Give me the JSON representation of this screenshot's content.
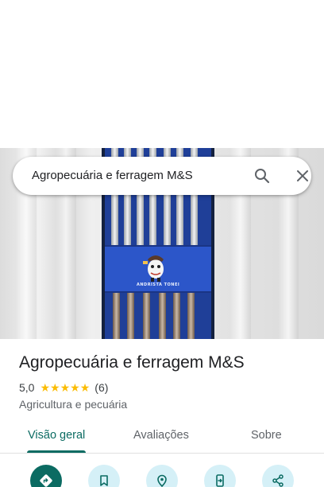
{
  "search": {
    "query": "Agropecuária e ferragem M&S",
    "search_icon": "search-icon",
    "close_icon": "close-icon"
  },
  "hero": {
    "mascot_caption": "ANDRISTA TONEI"
  },
  "place": {
    "name": "Agropecuária e ferragem M&S",
    "rating": "5,0",
    "stars": 5,
    "reviews": "(6)",
    "category": "Agricultura e pecuária"
  },
  "tabs": [
    {
      "label": "Visão geral",
      "active": true
    },
    {
      "label": "Avaliações",
      "active": false
    },
    {
      "label": "Sobre",
      "active": false
    }
  ],
  "actions": [
    {
      "icon": "directions-icon",
      "primary": true
    },
    {
      "icon": "bookmark-icon",
      "primary": false
    },
    {
      "icon": "nearby-icon",
      "primary": false
    },
    {
      "icon": "send-to-phone-icon",
      "primary": false
    },
    {
      "icon": "share-icon",
      "primary": false
    }
  ],
  "colors": {
    "accent": "#0b6b62",
    "star": "#fbbc04",
    "action_bg": "#d5f0f7"
  }
}
